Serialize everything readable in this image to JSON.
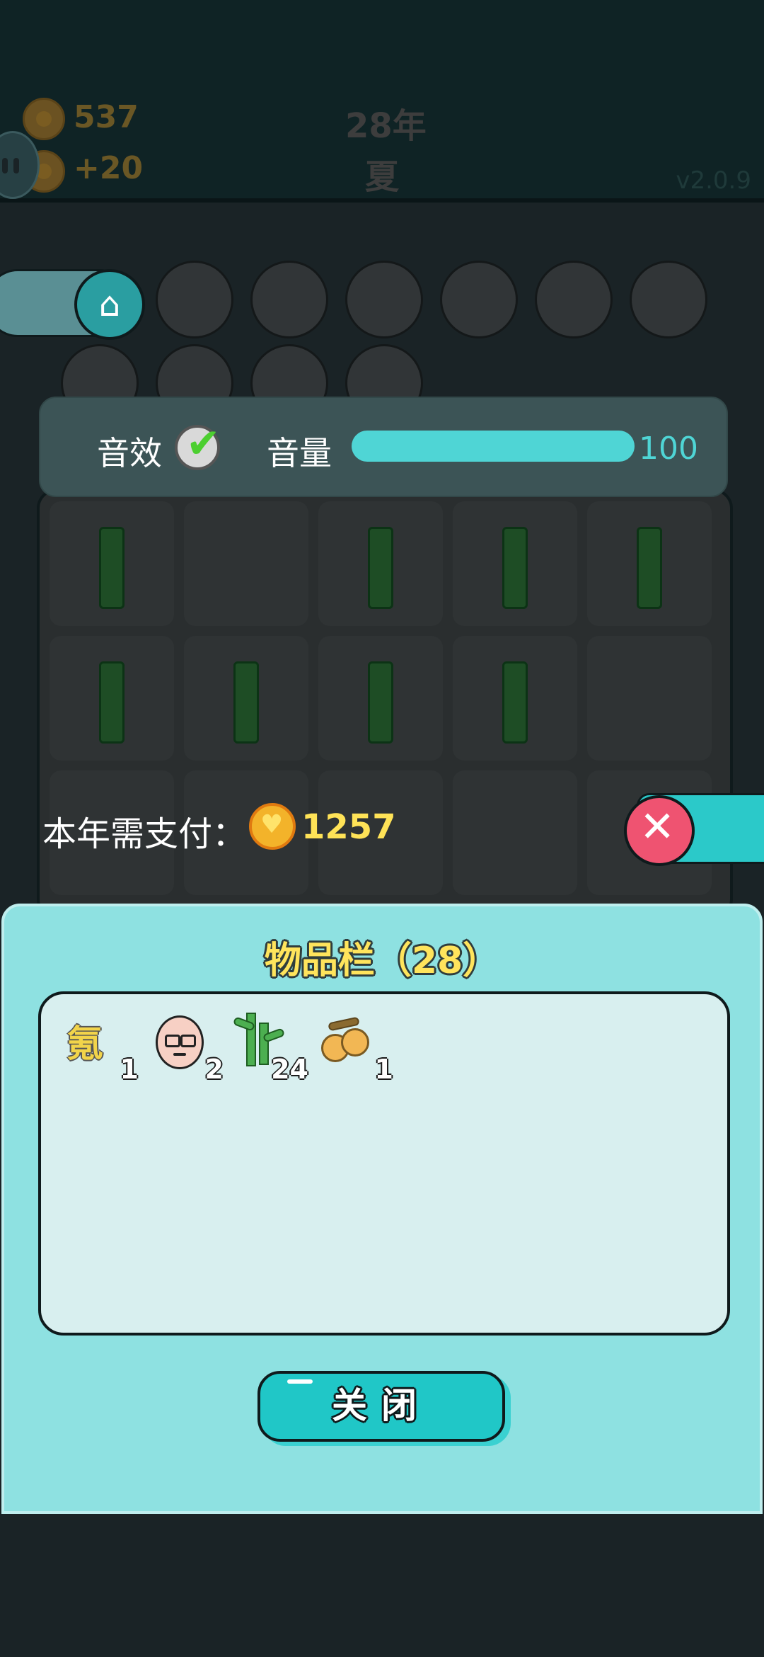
{
  "header": {
    "gold_amount": "537",
    "income": "+20",
    "year": "28年",
    "season": "夏",
    "version": "v2.0.9"
  },
  "settings": {
    "sound_effects_label": "音效",
    "sound_effects_enabled": true,
    "volume_label": "音量",
    "volume_value": "100",
    "volume_fraction": 1.0
  },
  "payment": {
    "label": "本年需支付：",
    "amount": "1257"
  },
  "inventory": {
    "title": "物品栏（28）",
    "items": [
      {
        "icon": "krypton-glyph",
        "glyph": "氪",
        "count": "1"
      },
      {
        "icon": "old-man-face-icon",
        "count": "2"
      },
      {
        "icon": "bamboo-icon",
        "count": "24"
      },
      {
        "icon": "fruit-icon",
        "count": "1"
      }
    ],
    "close_label": "关闭"
  },
  "colors": {
    "accent": "#20c7c7",
    "panel": "#8ee1e1",
    "coin": "#f3b32a",
    "title_yellow": "#ffe45c",
    "close_red": "#ef5371"
  }
}
